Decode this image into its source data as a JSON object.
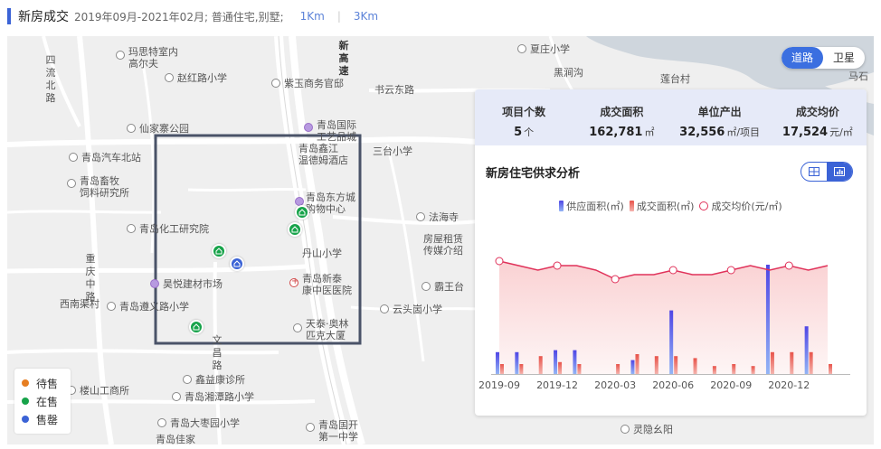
{
  "header": {
    "title": "新房成交",
    "meta": "2019年09月-2021年02月; 普通住宅,别墅;",
    "tab1": "1Km",
    "tab2": "3Km"
  },
  "map": {
    "toggle": [
      "道路",
      "卫星"
    ],
    "labels": {
      "l1": "玛思特室内",
      "l1b": "高尔夫",
      "l2": "赵红路小学",
      "l3": "紫玉商务官邸",
      "l4": "书云东路",
      "l5": "夏庄小学",
      "l6": "黑涧沟",
      "l7": "莲台村",
      "l8": "仙家寨公园",
      "l9": "青岛国际",
      "l9b": "工艺品城",
      "l10": "三台小学",
      "l11": "青岛汽车北站",
      "l12": "青岛鑫江",
      "l12b": "温德姆酒店",
      "l13": "青岛畜牧",
      "l13b": "饲料研究所",
      "l14": "青岛东方城",
      "l14b": "购物中心",
      "l15": "法海寺",
      "l16": "青岛化工研究院",
      "l17": "房屋租赁",
      "l17b": "传媒介绍",
      "l18": "丹山小学",
      "l19": "昊悦建材市场",
      "l20": "青岛新泰",
      "l20b": "康中医医院",
      "l21": "霸王台",
      "l22": "西南渠村",
      "l23": "青岛遵义路小学",
      "l24": "云头崮小学",
      "l25": "天泰·奥林",
      "l25b": "匹克大厦",
      "l26": "鑫益康诊所",
      "l27": "楼山工商所",
      "l28": "青岛湘潭路小学",
      "l29": "青岛大枣园小学",
      "l30": "灵隐幺阳",
      "l31": "青岛国开",
      "l31b": "第一中学",
      "l32": "青岛佳家",
      "l33": "马石",
      "road_v1": "新高速",
      "road_v2": "重庆中路",
      "road_v3": "文昌路",
      "road_v4": "四流北路"
    }
  },
  "legend": [
    {
      "label": "待售",
      "color": "#e67e22"
    },
    {
      "label": "在售",
      "color": "#17a34a"
    },
    {
      "label": "售罄",
      "color": "#3b63d6"
    }
  ],
  "stats": [
    {
      "key": "项目个数",
      "value": "5",
      "unit": "个"
    },
    {
      "key": "成交面积",
      "value": "162,781",
      "unit": "㎡"
    },
    {
      "key": "单位产出",
      "value": "32,556",
      "unit": "㎡/项目"
    },
    {
      "key": "成交均价",
      "value": "17,524",
      "unit": "元/㎡"
    }
  ],
  "panel": {
    "title": "新房住宅供求分析"
  },
  "chart_data": {
    "type": "bar",
    "categories": [
      "2019-09",
      "2019-10",
      "2019-11",
      "2019-12",
      "2020-01",
      "2020-02",
      "2020-03",
      "2020-04",
      "2020-05",
      "2020-06",
      "2020-07",
      "2020-08",
      "2020-09",
      "2020-10",
      "2020-11",
      "2020-12",
      "2021-01",
      "2021-02"
    ],
    "x_ticks": [
      "2019-09",
      "2019-12",
      "2020-03",
      "2020-06",
      "2020-09",
      "2020-12"
    ],
    "series": [
      {
        "name": "供应面积(㎡)",
        "values": [
          11,
          11,
          0,
          12,
          12,
          0,
          0,
          7,
          0,
          32,
          0,
          0,
          0,
          0,
          55,
          0,
          24,
          0
        ],
        "color": "#5b3fe0"
      },
      {
        "name": "成交面积(㎡)",
        "values": [
          5,
          5,
          9,
          6,
          5,
          0,
          5,
          10,
          9,
          9,
          8,
          4,
          5,
          4,
          11,
          11,
          11,
          5
        ],
        "color": "#e8534a"
      },
      {
        "name": "成交均价(元/㎡)",
        "values": [
          58,
          57,
          56,
          57,
          57,
          56,
          54,
          55,
          55,
          56,
          55,
          55,
          56,
          57,
          56,
          57,
          56,
          57
        ],
        "color": "#e0325a"
      }
    ],
    "markers": [
      0,
      3,
      6,
      9,
      12,
      15
    ],
    "colors": {
      "supply_top": "#4f46e5",
      "supply_bottom": "#93b4f5",
      "deal_top": "#e8534a",
      "deal_bottom": "#f4b3ad",
      "line": "#e0325a"
    }
  }
}
